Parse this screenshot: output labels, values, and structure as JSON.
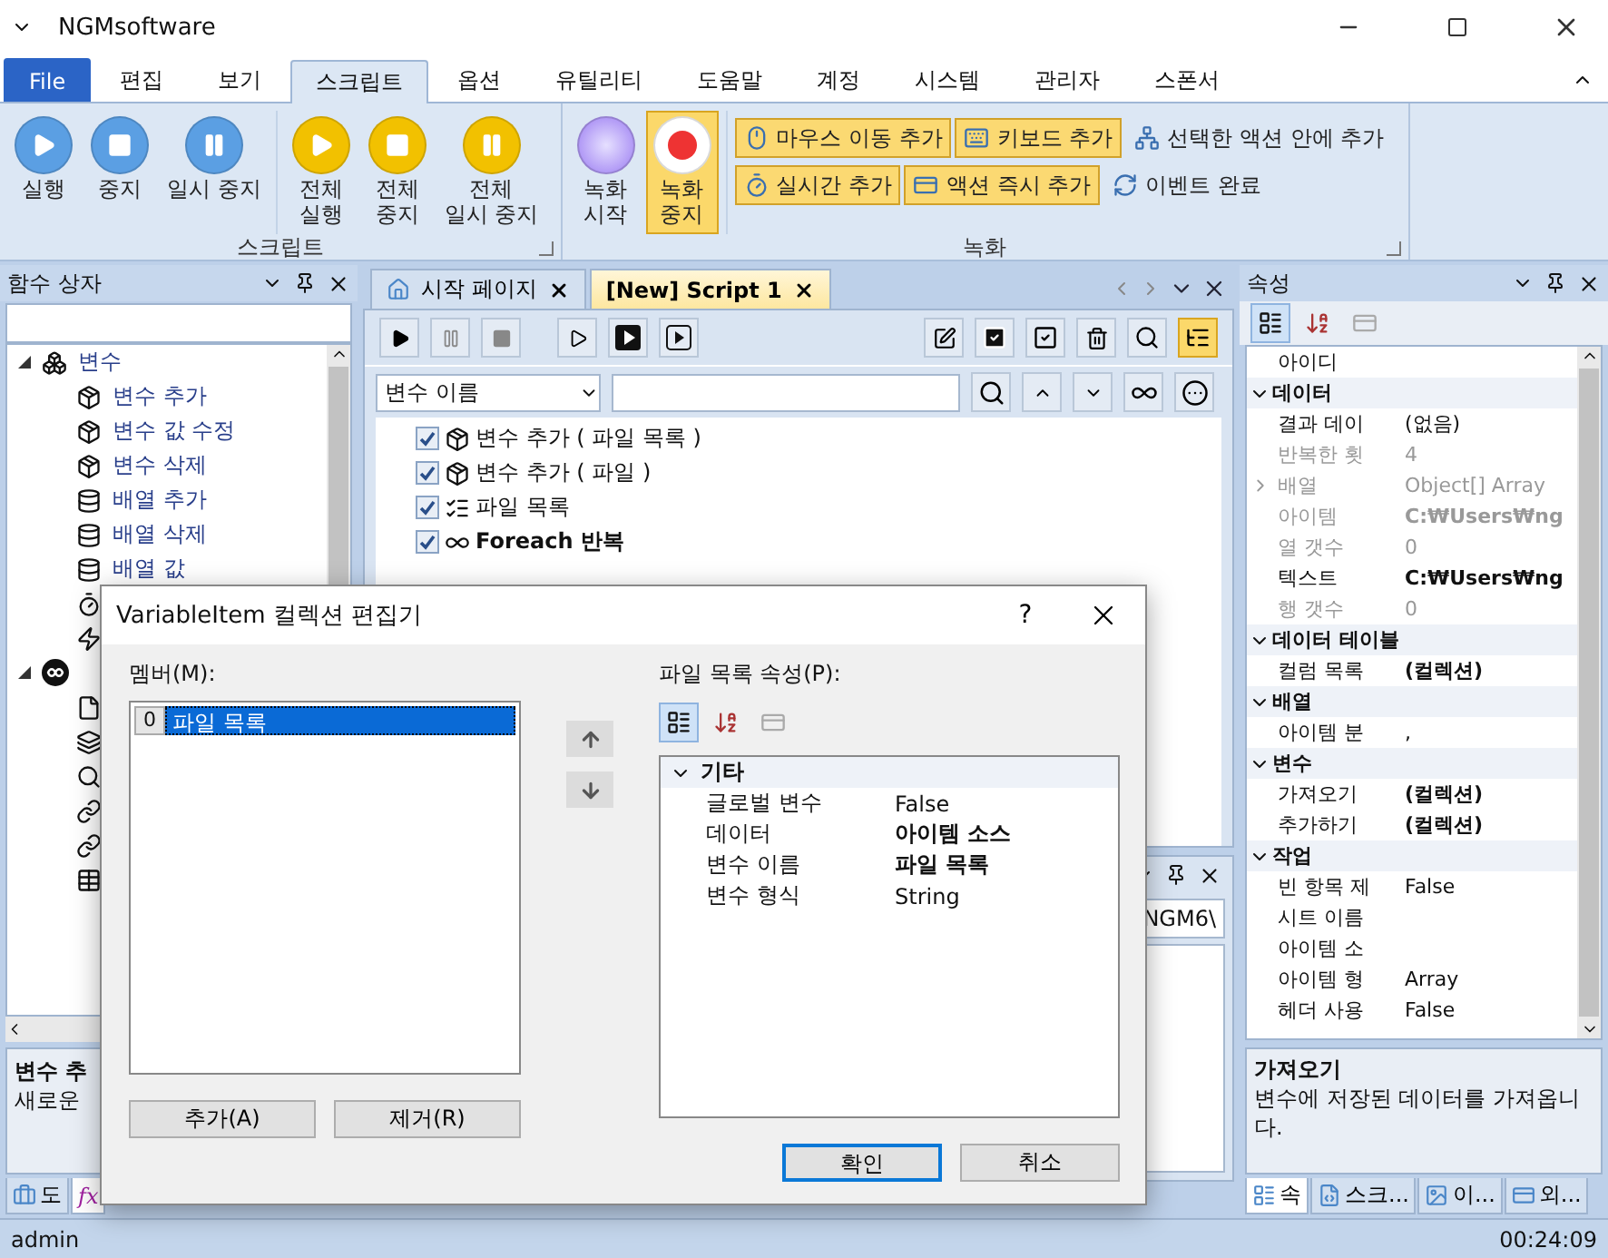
{
  "window": {
    "title": "NGMsoftware"
  },
  "menu_tabs": [
    {
      "label": "File",
      "kind": "file",
      "selected": false
    },
    {
      "label": "편집",
      "kind": "tab",
      "selected": false
    },
    {
      "label": "보기",
      "kind": "tab",
      "selected": false
    },
    {
      "label": "스크립트",
      "kind": "tab",
      "selected": true
    },
    {
      "label": "옵션",
      "kind": "tab",
      "selected": false
    },
    {
      "label": "유틸리티",
      "kind": "tab",
      "selected": false
    },
    {
      "label": "도움말",
      "kind": "tab",
      "selected": false
    },
    {
      "label": "계정",
      "kind": "tab",
      "selected": false
    },
    {
      "label": "시스템",
      "kind": "tab",
      "selected": false
    },
    {
      "label": "관리자",
      "kind": "tab",
      "selected": false
    },
    {
      "label": "스폰서",
      "kind": "tab",
      "selected": false
    }
  ],
  "ribbon": [
    {
      "title": "스크립트",
      "clusters": [
        {
          "kind": "large",
          "buttons": [
            {
              "label": "실행",
              "kind": "play",
              "color": "#5b9fe3",
              "active": false
            },
            {
              "label": "중지",
              "kind": "stop",
              "color": "#5b9fe3",
              "active": false
            },
            {
              "label": "일시 중지",
              "kind": "pause",
              "color": "#5b9fe3",
              "active": false
            }
          ]
        },
        {
          "kind": "large",
          "buttons": [
            {
              "label": "전체\n실행",
              "kind": "play",
              "color": "#f2c100",
              "active": false
            },
            {
              "label": "전체\n중지",
              "kind": "stop",
              "color": "#f2c100",
              "active": false
            },
            {
              "label": "전체\n일시 중지",
              "kind": "pause",
              "color": "#f2c100",
              "active": false
            }
          ]
        }
      ]
    },
    {
      "title": "녹화",
      "clusters": [
        {
          "kind": "large",
          "buttons": [
            {
              "label": "녹화\n시작",
              "kind": "record-start",
              "active": false
            },
            {
              "label": "녹화\n중지",
              "kind": "record-stop",
              "active": true
            }
          ]
        },
        {
          "kind": "small",
          "rows": [
            [
              {
                "label": "마우스 이동 추가",
                "kind": "mouse",
                "active": true
              },
              {
                "label": "키보드 추가",
                "kind": "keyboard",
                "active": true
              },
              {
                "label": "선택한 액션 안에 추가",
                "kind": "network",
                "active": false
              }
            ],
            [
              {
                "label": "실시간 추가",
                "kind": "timer",
                "active": true
              },
              {
                "label": "액션 즉시 추가",
                "kind": "action",
                "active": true
              },
              {
                "label": "이벤트 완료",
                "kind": "event",
                "active": false
              }
            ]
          ]
        }
      ]
    }
  ],
  "function_box": {
    "title": "함수 상자",
    "tree": [
      {
        "label": "변수",
        "kind": "variables",
        "expanded": true,
        "children": [
          {
            "label": "변수 추가",
            "kind": "variable"
          },
          {
            "label": "변수 값 수정",
            "kind": "variable"
          },
          {
            "label": "변수 삭제",
            "kind": "variable"
          },
          {
            "label": "배열 추가",
            "kind": "array"
          },
          {
            "label": "배열 삭제",
            "kind": "array"
          },
          {
            "label": "배열 값",
            "kind": "array"
          },
          {
            "kind": "timer"
          },
          {
            "kind": "event"
          }
        ]
      },
      {
        "kind": "loop",
        "expanded": true,
        "children": [
          {
            "kind": "document"
          },
          {
            "kind": "layers"
          },
          {
            "kind": "search"
          },
          {
            "kind": "link"
          },
          {
            "kind": "link"
          },
          {
            "kind": "table"
          }
        ]
      }
    ],
    "description": {
      "title": "변수 추",
      "text": "새로운"
    },
    "bottom_tabs": [
      {
        "label": "도",
        "kind": "toolbox",
        "selected": false
      },
      {
        "label": "fx",
        "kind": "function",
        "selected": true
      }
    ]
  },
  "document_tabs": [
    {
      "label": "시작 페이지",
      "kind": "home",
      "selected": false
    },
    {
      "label": "[New] Script 1",
      "kind": "script",
      "selected": true
    }
  ],
  "script_toolbar": {
    "tree_view": true
  },
  "filter": {
    "field": "변수 이름"
  },
  "actions": [
    {
      "label": "변수 추가 ( 파일 목록 )",
      "kind": "variable",
      "checked": true,
      "bold": false
    },
    {
      "label": "변수 추가 ( 파일 )",
      "kind": "variable",
      "checked": true,
      "bold": false
    },
    {
      "label": "파일 목록",
      "kind": "list",
      "checked": true,
      "bold": false
    },
    {
      "label": "Foreach 반복",
      "kind": "loop",
      "checked": true,
      "bold": true
    }
  ],
  "output_panel": {
    "path": "NGM6\\"
  },
  "properties": {
    "title": "속성",
    "rows": [
      {
        "kind": "property",
        "name": "아이디",
        "disabled": false
      },
      {
        "kind": "category",
        "label": "데이터",
        "expanded": true
      },
      {
        "kind": "property",
        "name": "결과 데이",
        "value": "(없음)",
        "disabled": false
      },
      {
        "kind": "property",
        "name": "반복한 횟",
        "value": "4",
        "disabled": true
      },
      {
        "kind": "property",
        "name": "배열",
        "value": "Object[] Array",
        "disabled": true,
        "expanded": false
      },
      {
        "kind": "property",
        "name": "아이템",
        "value": "C:₩Users₩ng",
        "disabled": true,
        "bold": true
      },
      {
        "kind": "property",
        "name": "열 갯수",
        "value": "0",
        "disabled": true
      },
      {
        "kind": "property",
        "name": "텍스트",
        "value": "C:₩Users₩ng",
        "disabled": false,
        "bold": true
      },
      {
        "kind": "property",
        "name": "행 갯수",
        "value": "0",
        "disabled": true
      },
      {
        "kind": "category",
        "label": "데이터 테이블",
        "expanded": true
      },
      {
        "kind": "property",
        "name": "컬럼 목록",
        "value": "(컬렉션)",
        "disabled": false,
        "bold": true
      },
      {
        "kind": "category",
        "label": "배열",
        "expanded": true
      },
      {
        "kind": "property",
        "name": "아이템 분",
        "value": ",",
        "disabled": false
      },
      {
        "kind": "category",
        "label": "변수",
        "expanded": true
      },
      {
        "kind": "property",
        "name": "가져오기",
        "value": "(컬렉션)",
        "disabled": false,
        "bold": true
      },
      {
        "kind": "property",
        "name": "추가하기",
        "value": "(컬렉션)",
        "disabled": false,
        "bold": true
      },
      {
        "kind": "category",
        "label": "작업",
        "expanded": true
      },
      {
        "kind": "property",
        "name": "빈 항목 제",
        "value": "False",
        "disabled": false
      },
      {
        "kind": "property",
        "name": "시트 이름",
        "disabled": false
      },
      {
        "kind": "property",
        "name": "아이템 소",
        "disabled": false
      },
      {
        "kind": "property",
        "name": "아이템 형",
        "value": "Array",
        "disabled": false
      },
      {
        "kind": "property",
        "name": "헤더 사용",
        "value": "False",
        "disabled": false
      }
    ],
    "description": {
      "title": "가져오기",
      "text": "변수에 저장된 데이터를 가져옵니다."
    },
    "bottom_tabs": [
      {
        "label": "속",
        "kind": "properties",
        "selected": true
      },
      {
        "label": "스크...",
        "kind": "script",
        "selected": false
      },
      {
        "label": "이...",
        "kind": "image",
        "selected": false
      },
      {
        "label": "외...",
        "kind": "api",
        "selected": false
      }
    ]
  },
  "dialog": {
    "title": "VariableItem 컬렉션 편집기",
    "help": "?",
    "members_label": "멤버(M):",
    "members": [
      {
        "index": "0",
        "label": "파일 목록",
        "selected": true
      }
    ],
    "add": "추가(A)",
    "remove": "제거(R)",
    "properties_label": "파일 목록 속성(P):",
    "rows": [
      {
        "kind": "category",
        "label": "기타",
        "expanded": true
      },
      {
        "kind": "property",
        "name": "글로벌 변수",
        "value": "False",
        "disabled": false
      },
      {
        "kind": "property",
        "name": "데이터",
        "value": "아이템 소스",
        "disabled": false,
        "bold": true
      },
      {
        "kind": "property",
        "name": "변수 이름",
        "value": "파일 목록",
        "disabled": false,
        "bold": true
      },
      {
        "kind": "property",
        "name": "변수 형식",
        "value": "String",
        "disabled": false
      }
    ],
    "ok": "확인",
    "cancel": "취소"
  },
  "status_bar": {
    "user": "admin",
    "time": "00:24:09"
  }
}
